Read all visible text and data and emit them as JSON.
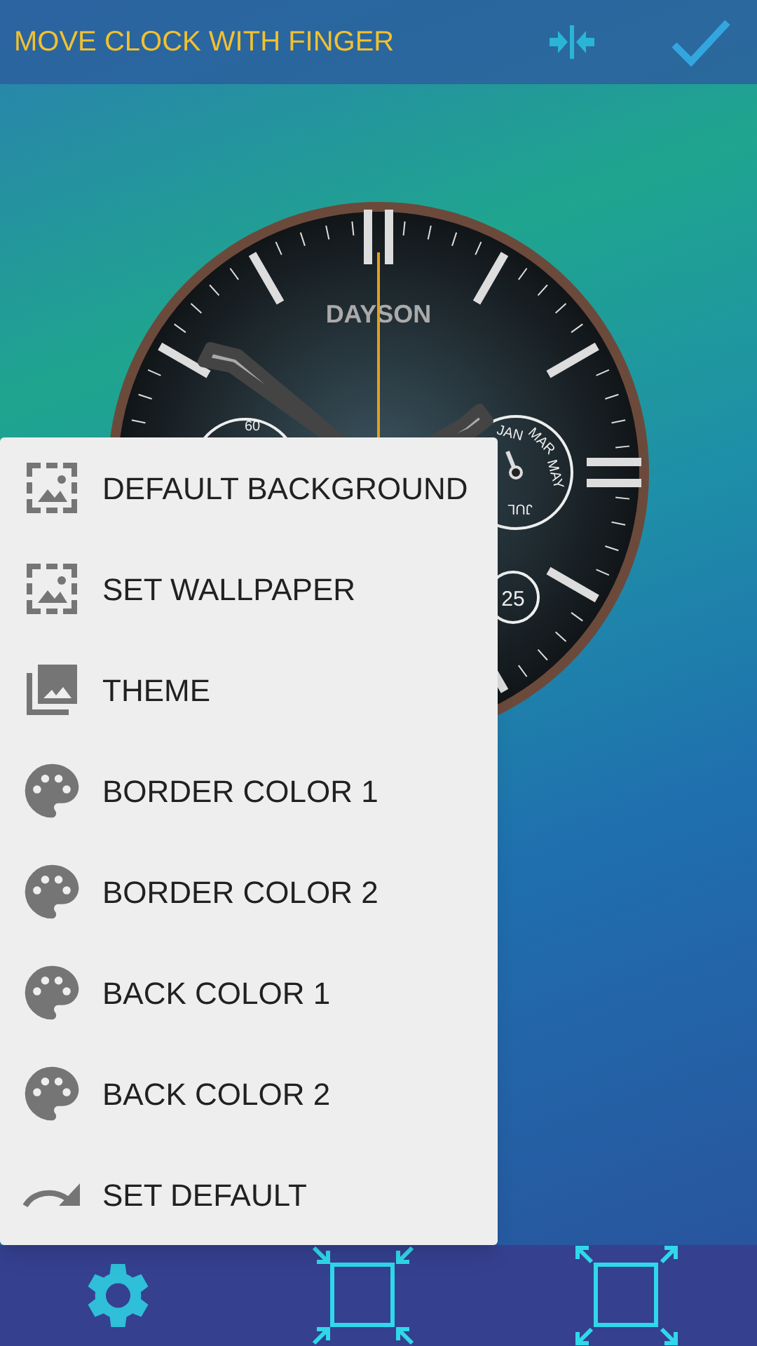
{
  "top_bar": {
    "title": "MOVE CLOCK WITH FINGER"
  },
  "clock": {
    "brand": "DAYSON",
    "left_subdial": "60",
    "months": [
      "JAN",
      "MAR",
      "MAY",
      "JUL"
    ],
    "date": "25"
  },
  "menu": [
    {
      "kind": "frame",
      "label": "DEFAULT BACKGROUND"
    },
    {
      "kind": "frame",
      "label": "SET WALLPAPER"
    },
    {
      "kind": "gallery",
      "label": "THEME"
    },
    {
      "kind": "palette",
      "label": "BORDER COLOR 1"
    },
    {
      "kind": "palette",
      "label": "BORDER COLOR 2"
    },
    {
      "kind": "palette",
      "label": "BACK COLOR 1"
    },
    {
      "kind": "palette",
      "label": "BACK COLOR 2"
    },
    {
      "kind": "redo",
      "label": "SET DEFAULT"
    }
  ]
}
